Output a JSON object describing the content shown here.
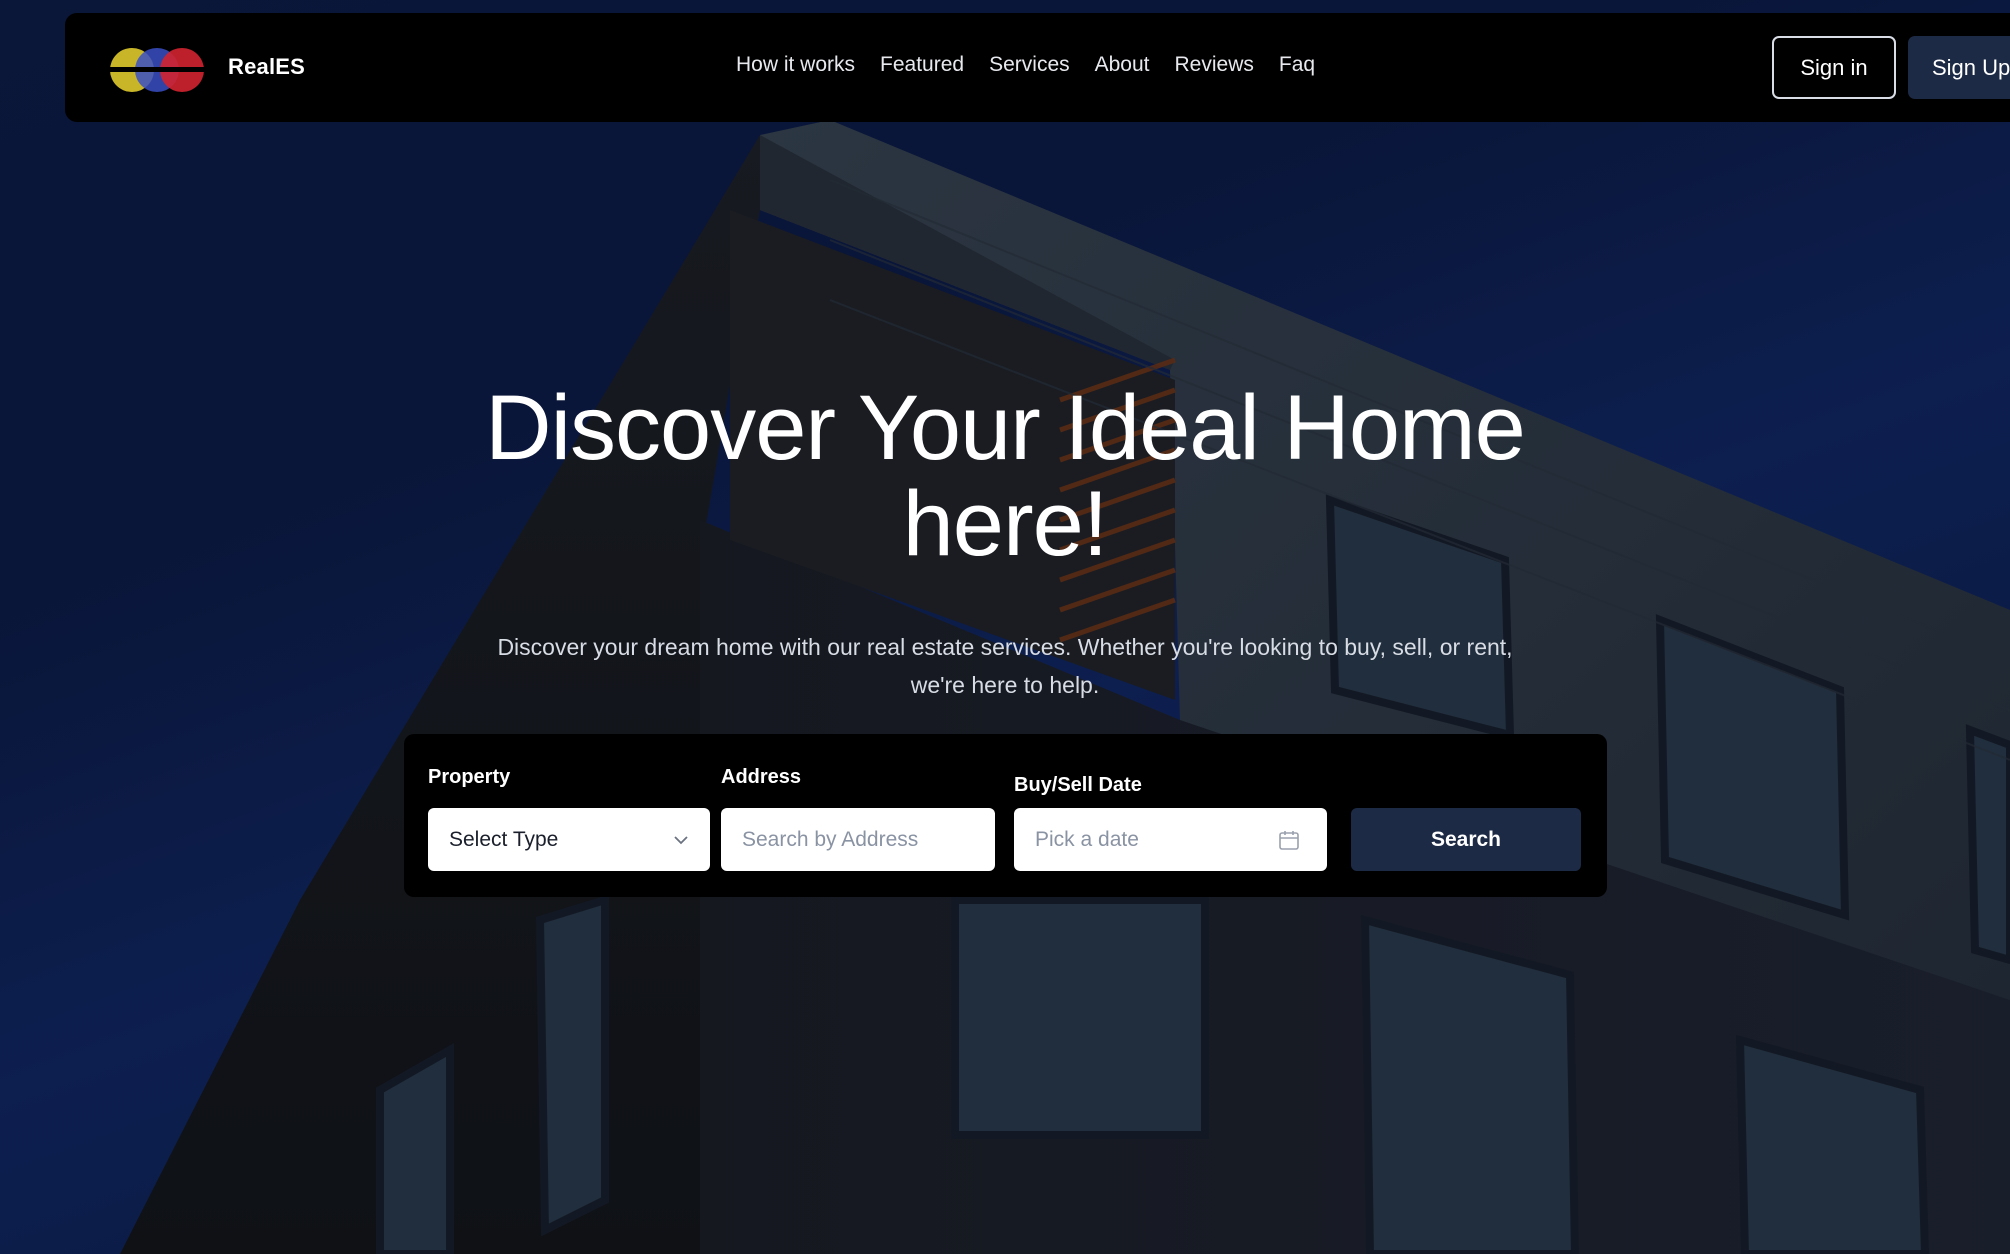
{
  "navbar": {
    "brand": "RealES",
    "links": [
      {
        "label": "How it works"
      },
      {
        "label": "Featured"
      },
      {
        "label": "Services"
      },
      {
        "label": "About"
      },
      {
        "label": "Reviews"
      },
      {
        "label": "Faq"
      }
    ],
    "signin_label": "Sign in",
    "signup_label": "Sign Up"
  },
  "hero": {
    "title_line1": "Discover Your Ideal Home",
    "title_line2": "here!",
    "subtitle_line1": "Discover your dream home with our real estate services. Whether you're looking to buy, sell, or rent,",
    "subtitle_line2": "we're here to help."
  },
  "search": {
    "property_label": "Property",
    "property_value": "Select Type",
    "address_label": "Address",
    "address_placeholder": "Search by Address",
    "date_label": "Buy/Sell Date",
    "date_placeholder": "Pick a date",
    "button_label": "Search"
  },
  "colors": {
    "navbar_bg": "#000000",
    "button_dark": "#1d2a45",
    "logo_yellow": "#d4c02a",
    "logo_blue": "#3a4fc4",
    "logo_red": "#d1232f"
  },
  "icons": {
    "select_chevron": "chevron-down-icon",
    "date_picker": "calendar-icon"
  }
}
